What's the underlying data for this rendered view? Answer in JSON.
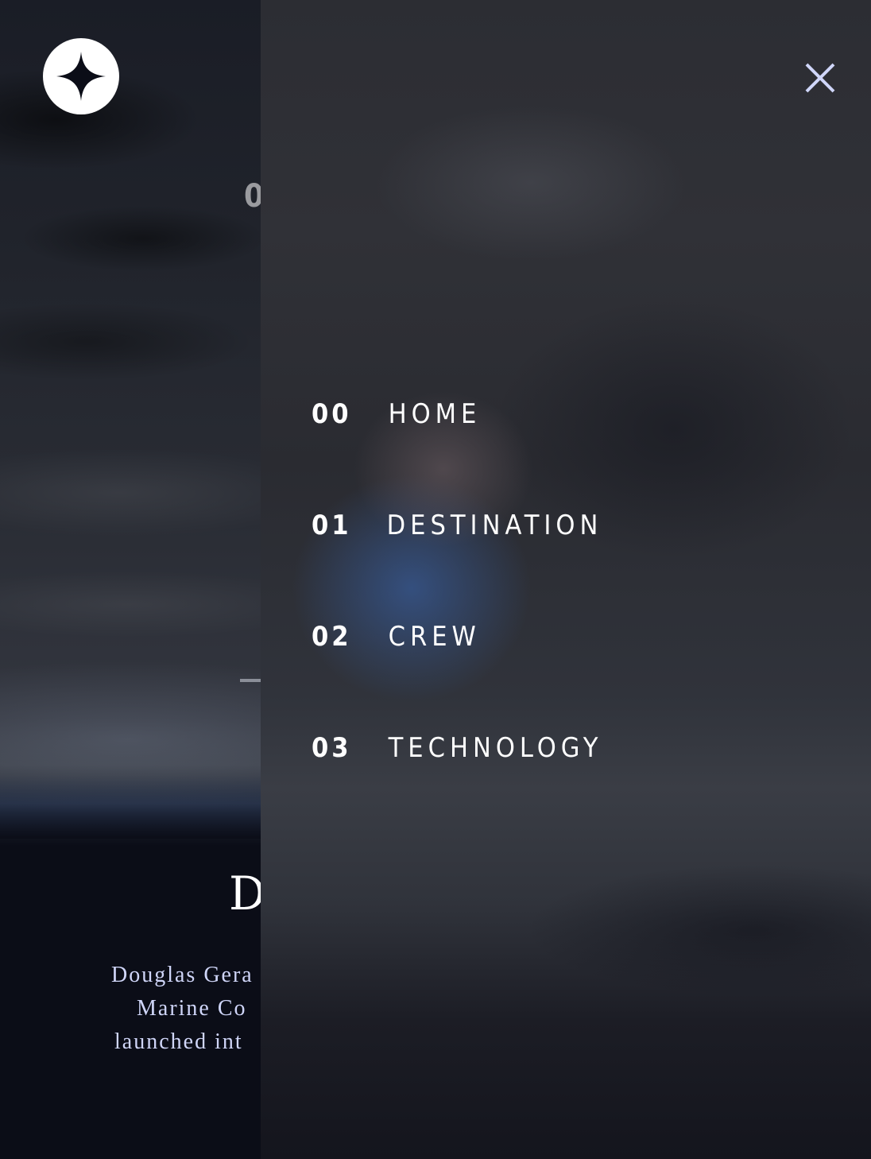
{
  "header": {
    "logo_icon": "star-icon",
    "page_number_partial": "0"
  },
  "crew": {
    "name_partial": "D",
    "bio_lines": [
      "Douglas Gera",
      "Marine Co",
      "launched int"
    ]
  },
  "nav": {
    "close_icon": "close-icon",
    "items": [
      {
        "number": "00",
        "label": "HOME"
      },
      {
        "number": "01",
        "label": "DESTINATION"
      },
      {
        "number": "02",
        "label": "CREW"
      },
      {
        "number": "03",
        "label": "TECHNOLOGY"
      }
    ]
  },
  "colors": {
    "accent": "#d0d6f9",
    "text": "#ffffff",
    "background": "#0b0d17"
  }
}
